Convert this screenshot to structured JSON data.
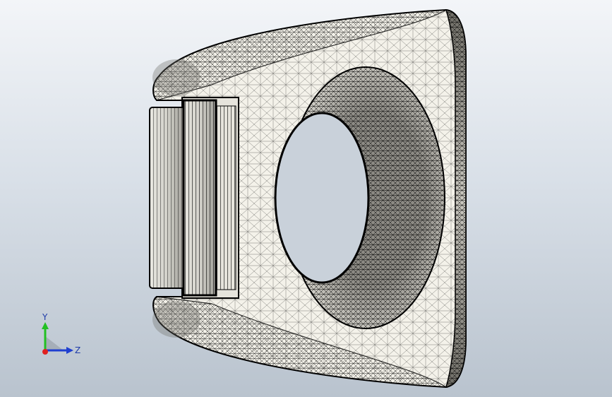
{
  "viewport": {
    "background_top": "#f3f5f8",
    "background_bottom": "#b9c3ce"
  },
  "model": {
    "face_color": "#f4f2ea",
    "mesh_color": "#000000",
    "shade_color": "#9a9890"
  },
  "triad": {
    "y_label": "Y",
    "z_label": "Z",
    "y_color": "#22c022",
    "z_color": "#1f3fd0",
    "x_color": "#e02020"
  }
}
